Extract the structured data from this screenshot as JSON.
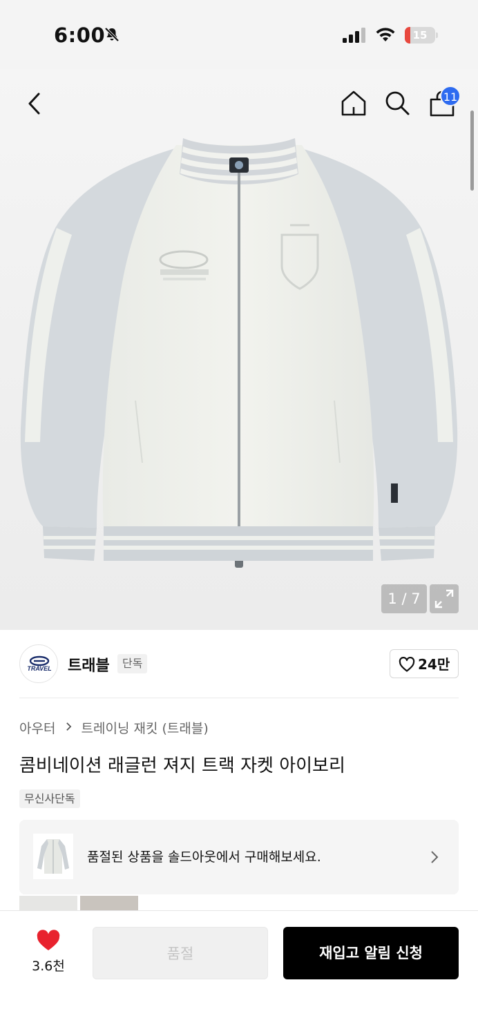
{
  "status_bar": {
    "time": "6:00",
    "battery_level": "15",
    "icons": [
      "bell-off-icon",
      "signal-icon",
      "wifi-icon",
      "battery-charging-icon"
    ]
  },
  "header": {
    "icons": [
      "back-icon",
      "home-icon",
      "search-icon",
      "cart-icon"
    ],
    "cart_count": "11"
  },
  "gallery": {
    "page_indicator": "1 / 7",
    "current_page": 1,
    "total_pages": 7
  },
  "brand": {
    "name": "트래블",
    "tag": "단독",
    "logo_text": "TRAVEL",
    "like_count": "24만"
  },
  "breadcrumb": {
    "category": "아우터",
    "subcategory": "트레이닝 재킷 (트래블)"
  },
  "product": {
    "title": "콤비네이션 래글런 져지 트랙 자켓 아이보리",
    "exclusive_badge": "무신사단독"
  },
  "soldout_banner": {
    "text": "품절된 상품을 솔드아웃에서 구매해보세요."
  },
  "bottom_bar": {
    "fav_count": "3.6천",
    "soldout_label": "품절",
    "restock_label": "재입고 알림 신청"
  },
  "colors": {
    "accent_blue": "#2e6bf0",
    "heart_red": "#e8222e",
    "battery_red": "#e8483e",
    "button_black": "#000000"
  }
}
